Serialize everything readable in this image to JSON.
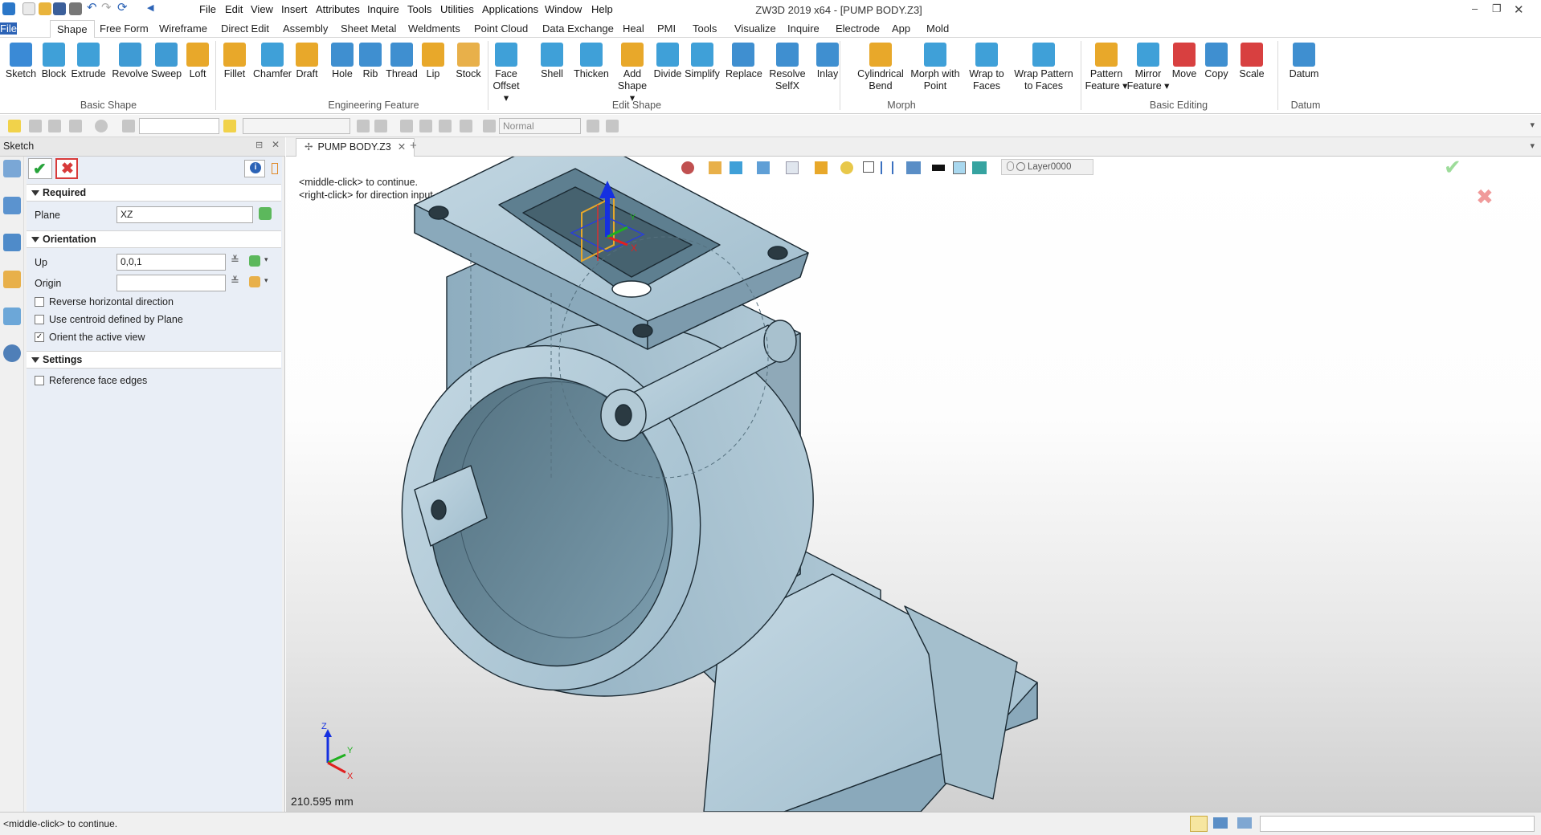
{
  "app": {
    "title": "ZW3D 2019  x64 - [PUMP BODY.Z3]"
  },
  "menubar": [
    "File",
    "Edit",
    "View",
    "Insert",
    "Attributes",
    "Inquire",
    "Tools",
    "Utilities",
    "Applications",
    "Window",
    "Help"
  ],
  "ribbon_tabs": [
    "File",
    "Shape",
    "Free Form",
    "Wireframe",
    "Direct Edit",
    "Assembly",
    "Sheet Metal",
    "Weldments",
    "Point Cloud",
    "Data Exchange",
    "Heal",
    "PMI",
    "Tools",
    "Visualize",
    "Inquire",
    "Electrode",
    "App",
    "Mold"
  ],
  "ribbon": {
    "buttons": [
      {
        "label": "Sketch",
        "label2": "",
        "icon": "sketch-icon",
        "color": "#3a8ad6"
      },
      {
        "label": "Block",
        "label2": "",
        "icon": "block-icon",
        "color": "#3fa0d8"
      },
      {
        "label": "Extrude",
        "label2": "",
        "icon": "extrude-icon",
        "color": "#3fa0d8"
      },
      {
        "label": "Revolve",
        "label2": "",
        "icon": "revolve-icon",
        "color": "#3f9bd4"
      },
      {
        "label": "Sweep",
        "label2": "",
        "icon": "sweep-icon",
        "color": "#3f9bd4"
      },
      {
        "label": "Loft",
        "label2": "",
        "icon": "loft-icon",
        "color": "#e8a82a"
      },
      {
        "label": "Fillet",
        "label2": "",
        "icon": "fillet-icon",
        "color": "#e8a82a"
      },
      {
        "label": "Chamfer",
        "label2": "",
        "icon": "chamfer-icon",
        "color": "#3fa0d8"
      },
      {
        "label": "Draft",
        "label2": "",
        "icon": "draft-icon",
        "color": "#e8a82a"
      },
      {
        "label": "Hole",
        "label2": "",
        "icon": "hole-icon",
        "color": "#3f8fd0"
      },
      {
        "label": "Rib",
        "label2": "",
        "icon": "rib-icon",
        "color": "#3f8fd0"
      },
      {
        "label": "Thread",
        "label2": "",
        "icon": "thread-icon",
        "color": "#3f8fd0"
      },
      {
        "label": "Lip",
        "label2": "",
        "icon": "lip-icon",
        "color": "#e8a82a"
      },
      {
        "label": "Stock",
        "label2": "",
        "icon": "stock-icon",
        "color": "#e8b04a"
      },
      {
        "label": "Face",
        "label2": "Offset ▾",
        "icon": "face-offset-icon",
        "color": "#3fa0d8"
      },
      {
        "label": "Shell",
        "label2": "",
        "icon": "shell-icon",
        "color": "#3fa0d8"
      },
      {
        "label": "Thicken",
        "label2": "",
        "icon": "thicken-icon",
        "color": "#3fa0d8"
      },
      {
        "label": "Add",
        "label2": "Shape ▾",
        "icon": "add-shape-icon",
        "color": "#e8a82a"
      },
      {
        "label": "Divide",
        "label2": "",
        "icon": "divide-icon",
        "color": "#3fa0d8"
      },
      {
        "label": "Simplify",
        "label2": "",
        "icon": "simplify-icon",
        "color": "#3fa0d8"
      },
      {
        "label": "Replace",
        "label2": "",
        "icon": "replace-icon",
        "color": "#3f8fd0"
      },
      {
        "label": "Resolve",
        "label2": "SelfX",
        "icon": "resolve-selfx-icon",
        "color": "#3f8fd0"
      },
      {
        "label": "Inlay",
        "label2": "",
        "icon": "inlay-icon",
        "color": "#3f8fd0"
      },
      {
        "label": "Cylindrical",
        "label2": "Bend",
        "icon": "cylindrical-bend-icon",
        "color": "#e8a82a"
      },
      {
        "label": "Morph with",
        "label2": "Point",
        "icon": "morph-point-icon",
        "color": "#3fa0d8"
      },
      {
        "label": "Wrap to",
        "label2": "Faces",
        "icon": "wrap-faces-icon",
        "color": "#3fa0d8"
      },
      {
        "label": "Wrap Pattern",
        "label2": "to Faces",
        "icon": "wrap-pattern-icon",
        "color": "#3fa0d8"
      },
      {
        "label": "Pattern",
        "label2": "Feature ▾",
        "icon": "pattern-feature-icon",
        "color": "#e8a82a"
      },
      {
        "label": "Mirror",
        "label2": "Feature ▾",
        "icon": "mirror-feature-icon",
        "color": "#3fa0d8"
      },
      {
        "label": "Move",
        "label2": "",
        "icon": "move-icon",
        "color": "#d84040"
      },
      {
        "label": "Copy",
        "label2": "",
        "icon": "copy-icon",
        "color": "#3f8fd0"
      },
      {
        "label": "Scale",
        "label2": "",
        "icon": "scale-icon",
        "color": "#d84040"
      },
      {
        "label": "Datum",
        "label2": "",
        "icon": "datum-icon",
        "color": "#3f8fd0"
      }
    ],
    "groups": [
      "Basic Shape",
      "Engineering Feature",
      "Edit Shape",
      "Morph",
      "Basic Editing",
      "Datum"
    ]
  },
  "toolbar": {
    "filter_value": "Normal"
  },
  "panel": {
    "title": "Sketch",
    "sections": {
      "required": "Required",
      "orientation": "Orientation",
      "settings": "Settings"
    },
    "fields": {
      "plane_label": "Plane",
      "plane_value": "XZ",
      "up_label": "Up",
      "up_value": "0,0,1",
      "origin_label": "Origin",
      "origin_value": ""
    },
    "checkboxes": [
      {
        "label": "Reverse horizontal direction",
        "checked": false
      },
      {
        "label": "Use centroid defined by Plane",
        "checked": false
      },
      {
        "label": "Orient the active view",
        "checked": true
      }
    ],
    "settings_checkbox": {
      "label": "Reference face edges",
      "checked": false
    }
  },
  "doc": {
    "tab_title": "PUMP BODY.Z3"
  },
  "viewport": {
    "hint_line1": "<middle-click> to continue.",
    "hint_line2": "<right-click> for direction input options",
    "scale": "210.595 mm",
    "layer": "Layer0000",
    "triad_axes": [
      "Z",
      "Y",
      "X"
    ],
    "gizmo_axes": [
      "Y",
      "X"
    ]
  },
  "statusbar": {
    "message": "<middle-click> to continue."
  },
  "colors": {
    "file_tab": "#2c63b6",
    "model_fill": "#a9c3d1",
    "accept": "#27a33a",
    "cancel": "#d83a3a"
  }
}
